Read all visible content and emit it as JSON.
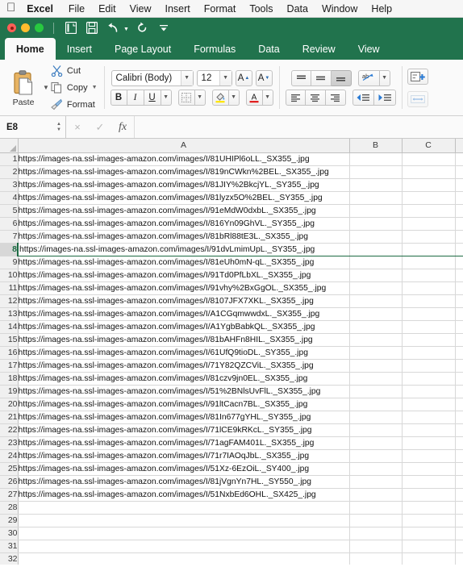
{
  "menubar": {
    "apple": "apple-logo",
    "items": [
      {
        "label": "Excel",
        "bold": true
      },
      {
        "label": "File"
      },
      {
        "label": "Edit"
      },
      {
        "label": "View"
      },
      {
        "label": "Insert"
      },
      {
        "label": "Format"
      },
      {
        "label": "Tools"
      },
      {
        "label": "Data"
      },
      {
        "label": "Window"
      },
      {
        "label": "Help"
      }
    ]
  },
  "window_controls": {
    "close": "close-window-button",
    "minimize": "minimize-window-button",
    "zoom": "zoom-window-button"
  },
  "quick_access": {
    "buttons": [
      {
        "name": "new-document-icon",
        "title": "New"
      },
      {
        "name": "save-icon",
        "title": "Save"
      },
      {
        "name": "undo-icon",
        "title": "Undo"
      },
      {
        "name": "redo-icon",
        "title": "Redo"
      },
      {
        "name": "customize-toolbar-icon",
        "title": "Customize"
      }
    ]
  },
  "ribbon": {
    "tabs": [
      {
        "label": "Home",
        "active": true
      },
      {
        "label": "Insert",
        "active": false
      },
      {
        "label": "Page Layout",
        "active": false
      },
      {
        "label": "Formulas",
        "active": false
      },
      {
        "label": "Data",
        "active": false
      },
      {
        "label": "Review",
        "active": false
      },
      {
        "label": "View",
        "active": false
      }
    ],
    "clipboard": {
      "paste_label": "Paste",
      "cut_label": "Cut",
      "copy_label": "Copy",
      "format_label": "Format"
    },
    "font": {
      "font_name": "Calibri (Body)",
      "font_size": "12",
      "grow_font": "A",
      "shrink_font": "A",
      "bold": "B",
      "italic": "I",
      "underline": "U",
      "highlight_color": "#ffe600",
      "font_color": "#e02020"
    },
    "alignment": {
      "wrap_text_label": "ab"
    }
  },
  "formula_bar": {
    "name_box": "E8",
    "cancel": "×",
    "confirm": "✓",
    "fx": "fx",
    "formula_value": ""
  },
  "grid": {
    "columns": [
      "A",
      "B",
      "C"
    ],
    "selected_cell": "E8",
    "selected_row": 8,
    "total_visible_rows": 32,
    "rows": [
      {
        "n": 1,
        "a": "https://images-na.ssl-images-amazon.com/images/I/81UHIPl6oLL._SX355_.jpg"
      },
      {
        "n": 2,
        "a": "https://images-na.ssl-images-amazon.com/images/I/819nCWkn%2BEL._SX355_.jpg"
      },
      {
        "n": 3,
        "a": "https://images-na.ssl-images-amazon.com/images/I/81JIY%2BkcjYL._SY355_.jpg"
      },
      {
        "n": 4,
        "a": "https://images-na.ssl-images-amazon.com/images/I/81lyzx5O%2BEL._SY355_.jpg"
      },
      {
        "n": 5,
        "a": "https://images-na.ssl-images-amazon.com/images/I/91eMdW0dxbL._SX355_.jpg"
      },
      {
        "n": 6,
        "a": "https://images-na.ssl-images-amazon.com/images/I/816Yn09GhVL._SY355_.jpg"
      },
      {
        "n": 7,
        "a": "https://images-na.ssl-images-amazon.com/images/I/81bRl88tE3L._SX355_.jpg"
      },
      {
        "n": 8,
        "a": "https://images-na.ssl-images-amazon.com/images/I/91dvLmimUpL._SY355_.jpg"
      },
      {
        "n": 9,
        "a": "https://images-na.ssl-images-amazon.com/images/I/81eUh0mN-qL._SX355_.jpg"
      },
      {
        "n": 10,
        "a": "https://images-na.ssl-images-amazon.com/images/I/91Td0PfLbXL._SX355_.jpg"
      },
      {
        "n": 11,
        "a": "https://images-na.ssl-images-amazon.com/images/I/91vhy%2BxGgOL._SX355_.jpg"
      },
      {
        "n": 12,
        "a": "https://images-na.ssl-images-amazon.com/images/I/8107JFX7XKL._SX355_.jpg"
      },
      {
        "n": 13,
        "a": "https://images-na.ssl-images-amazon.com/images/I/A1CGqmwwdxL._SX355_.jpg"
      },
      {
        "n": 14,
        "a": "https://images-na.ssl-images-amazon.com/images/I/A1YgbBabkQL._SX355_.jpg"
      },
      {
        "n": 15,
        "a": "https://images-na.ssl-images-amazon.com/images/I/81bAHFn8HIL._SX355_.jpg"
      },
      {
        "n": 16,
        "a": "https://images-na.ssl-images-amazon.com/images/I/61UfQ9tioDL._SY355_.jpg"
      },
      {
        "n": 17,
        "a": "https://images-na.ssl-images-amazon.com/images/I/71Y82QZCViL._SX355_.jpg"
      },
      {
        "n": 18,
        "a": "https://images-na.ssl-images-amazon.com/images/I/81czv9jn0EL._SX355_.jpg"
      },
      {
        "n": 19,
        "a": "https://images-na.ssl-images-amazon.com/images/I/51%2BNlsUvFlL._SX355_.jpg"
      },
      {
        "n": 20,
        "a": "https://images-na.ssl-images-amazon.com/images/I/91ltCacn7BL._SX355_.jpg"
      },
      {
        "n": 21,
        "a": "https://images-na.ssl-images-amazon.com/images/I/81In677gYHL._SY355_.jpg"
      },
      {
        "n": 22,
        "a": "https://images-na.ssl-images-amazon.com/images/I/71lCE9kRKcL._SY355_.jpg"
      },
      {
        "n": 23,
        "a": "https://images-na.ssl-images-amazon.com/images/I/71agFAM401L._SX355_.jpg"
      },
      {
        "n": 24,
        "a": "https://images-na.ssl-images-amazon.com/images/I/71r7IAOqJbL._SX355_.jpg"
      },
      {
        "n": 25,
        "a": "https://images-na.ssl-images-amazon.com/images/I/51Xz-6EzOiL._SY400_.jpg"
      },
      {
        "n": 26,
        "a": "https://images-na.ssl-images-amazon.com/images/I/81jVgnYn7HL._SY550_.jpg"
      },
      {
        "n": 27,
        "a": "https://images-na.ssl-images-amazon.com/images/I/51NxbEd6OHL._SX425_.jpg"
      },
      {
        "n": 28,
        "a": ""
      },
      {
        "n": 29,
        "a": ""
      },
      {
        "n": 30,
        "a": ""
      },
      {
        "n": 31,
        "a": ""
      },
      {
        "n": 32,
        "a": ""
      }
    ]
  },
  "colors": {
    "brand_green": "#21734d",
    "selection_green": "#1d6b44",
    "ribbon_bg": "#fafafa"
  }
}
